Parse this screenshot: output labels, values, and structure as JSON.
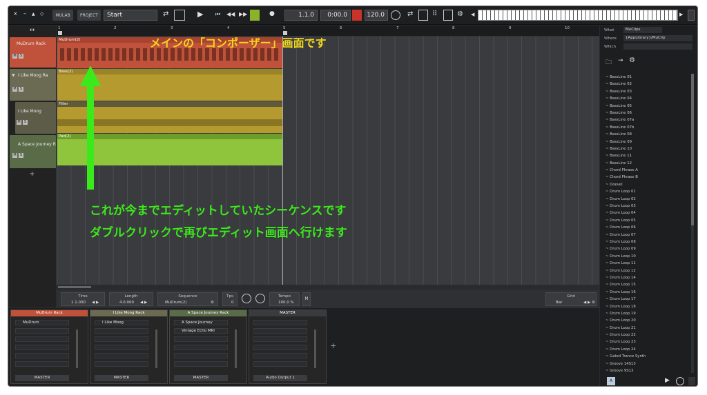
{
  "toolbar": {
    "window_controls": [
      "x",
      "–",
      "▲",
      "◇"
    ],
    "mulab_label": "MULAB",
    "project_label": "PROJECT",
    "project_name": "Start",
    "position": "1.1.0",
    "time": "0:00.0",
    "tempo": "120.0"
  },
  "ruler": {
    "bars": [
      "1",
      "2",
      "3",
      "4",
      "5",
      "6",
      "7",
      "8",
      "9",
      "10"
    ]
  },
  "tracks": [
    {
      "name": "MuDrum Rack"
    },
    {
      "name": "I Like Moog Ra"
    },
    {
      "name": "I Like Moog"
    },
    {
      "name": "A Space Journey R"
    }
  ],
  "add_track_label": "+",
  "clips": [
    {
      "name": "MuDrum(2)"
    },
    {
      "name": "Bass(2)"
    },
    {
      "name": "Filter"
    },
    {
      "name": "Pad(2)"
    }
  ],
  "infobar": {
    "time_label": "Time",
    "time_value": "1.1.000",
    "length_label": "Length",
    "length_value": "4.0.000",
    "sequence_label": "Sequence",
    "sequence_value": "MuDrum(2)",
    "tps_label": "Tps",
    "tps_value": "0",
    "tempo_label": "Tempo",
    "tempo_value": "100.0 %",
    "m_label": "M",
    "grid_label": "Grid",
    "grid_value": "Bar"
  },
  "mixer": {
    "strips": [
      {
        "title": "MuDrum Rack",
        "slot1": "MuDrum",
        "slot2": "",
        "output": "MASTER",
        "color": "#c0513a"
      },
      {
        "title": "I Like Moog Rack",
        "slot1": "I Like Moog",
        "slot2": "",
        "output": "MASTER",
        "color": "#b59a30"
      },
      {
        "title": "A Space Journey Rack",
        "slot1": "A Space Journey",
        "slot2": "Vintage Echo MKI",
        "output": "MASTER",
        "color": "#7fae3a"
      },
      {
        "title": "MASTER",
        "slot1": "",
        "slot2": "",
        "output": "Audio Output 1",
        "color": "#3a3b3e"
      }
    ],
    "add_label": "+"
  },
  "browser": {
    "what_label": "What",
    "what_value": "MuClips",
    "where_label": "Where",
    "where_value": "{AppLibrary}/MuClip",
    "which_label": "Which",
    "items": [
      "BassLine 01",
      "BassLine 02",
      "BassLine 03",
      "BassLine 04",
      "BassLine 05",
      "BassLine 06",
      "BassLine 07a",
      "BassLine 07b",
      "BassLine 08",
      "BassLine 09",
      "BassLine 10",
      "BassLine 11",
      "BassLine 12",
      "Chord Phrase A",
      "Chord Phrase B",
      "Doevel",
      "Drum Loop 01",
      "Drum Loop 02",
      "Drum Loop 03",
      "Drum Loop 04",
      "Drum Loop 05",
      "Drum Loop 06",
      "Drum Loop 07",
      "Drum Loop 08",
      "Drum Loop 09",
      "Drum Loop 10",
      "Drum Loop 11",
      "Drum Loop 12",
      "Drum Loop 14",
      "Drum Loop 15",
      "Drum Loop 16",
      "Drum Loop 17",
      "Drum Loop 18",
      "Drum Loop 19",
      "Drum Loop 20",
      "Drum Loop 21",
      "Drum Loop 22",
      "Drum Loop 23",
      "Drum Loop 24",
      "Gated Trance Synth",
      "Groove 14S13",
      "Groove 9S13"
    ],
    "footer_a": "A"
  },
  "annotations": {
    "composer_title": "メインの「コンポーザー」画面です",
    "line1": "これが今までエディットしていたシーケンスです",
    "line2": "ダブルクリックで再びエディット画面へ行けます"
  },
  "colors": {
    "drum": "#c0513a",
    "bass": "#b59a30",
    "pad": "#8ec53d",
    "annotation_green": "#3bea1a",
    "annotation_yellow": "#f2d81c"
  }
}
